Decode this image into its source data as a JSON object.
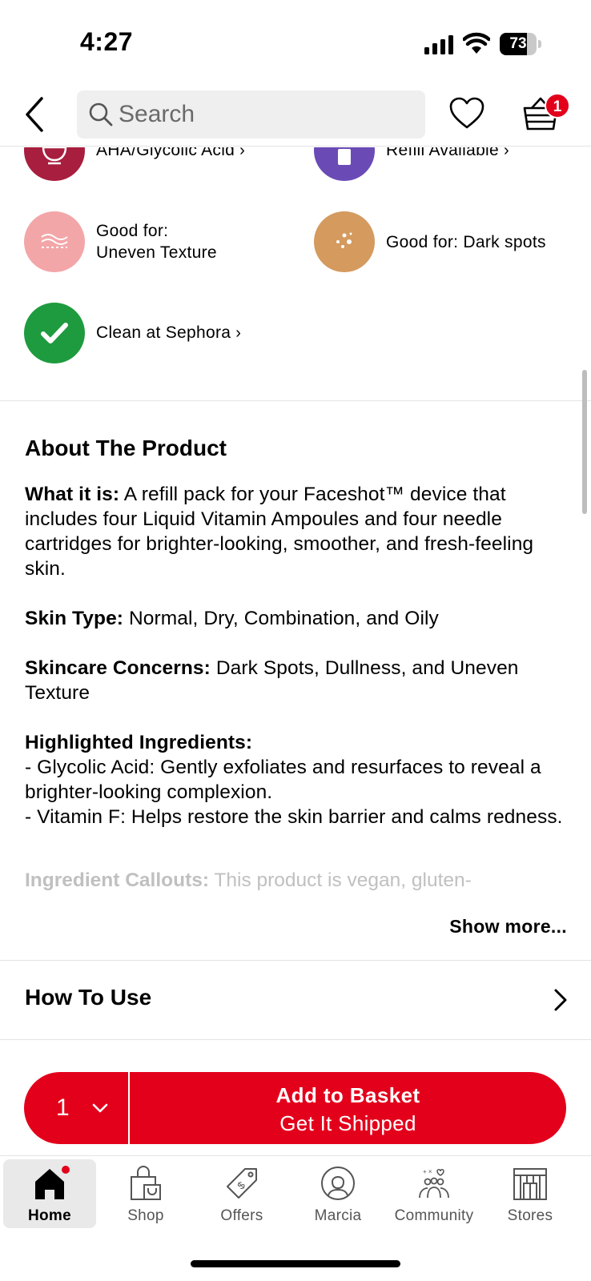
{
  "status_bar": {
    "time": "4:27",
    "battery": "73",
    "battery_level": 0.73
  },
  "header": {
    "search_placeholder": "Search",
    "basket_count": "1"
  },
  "features": [
    {
      "label": "AHA/Glycolic Acid",
      "has_link": true,
      "color": "#a81e3e",
      "icon": "bowl-icon"
    },
    {
      "label": "Refill Available",
      "has_link": true,
      "color": "#6a4bb6",
      "icon": "bottle-icon"
    },
    {
      "label_line1": "Good for:",
      "label_line2": "Uneven Texture",
      "color": "#f3a6a8",
      "icon": "texture-icon"
    },
    {
      "label": "Good for: Dark spots",
      "color": "#d49a5e",
      "icon": "dots-icon"
    },
    {
      "label": "Clean at Sephora",
      "has_link": true,
      "color": "#1e9b3e",
      "icon": "checkmark-icon"
    }
  ],
  "about": {
    "title": "About The Product",
    "what_label": "What it is:",
    "what_text": " A refill pack for your Faceshot™ device that includes four Liquid Vitamin Ampoules and four needle cartridges for brighter-looking, smoother, and fresh-feeling skin.",
    "skin_type_label": "Skin Type:",
    "skin_type_text": " Normal, Dry, Combination, and Oily",
    "concerns_label": "Skincare Concerns:",
    "concerns_text": " Dark Spots, Dullness, and Uneven Texture",
    "ingredients_label": "Highlighted Ingredients:",
    "ingredient_1": "- Glycolic Acid: Gently exfoliates and resurfaces to reveal a brighter-looking complexion.",
    "ingredient_2": "- Vitamin F: Helps restore the skin barrier and calms redness.",
    "callouts_label": "Ingredient Callouts:",
    "callouts_text": " This product is vegan, gluten-",
    "show_more": "Show more..."
  },
  "how_to_use": {
    "label": "How To Use"
  },
  "add_to_basket": {
    "quantity": "1",
    "line1": "Add to Basket",
    "line2": "Get It Shipped"
  },
  "bottom_nav": [
    {
      "label": "Home",
      "icon": "home-icon",
      "active": true
    },
    {
      "label": "Shop",
      "icon": "shopping-bag-icon"
    },
    {
      "label": "Offers",
      "icon": "tag-icon"
    },
    {
      "label": "Marcia",
      "icon": "profile-icon"
    },
    {
      "label": "Community",
      "icon": "community-icon"
    },
    {
      "label": "Stores",
      "icon": "store-icon"
    }
  ],
  "colors": {
    "brand_red": "#e3001b"
  }
}
